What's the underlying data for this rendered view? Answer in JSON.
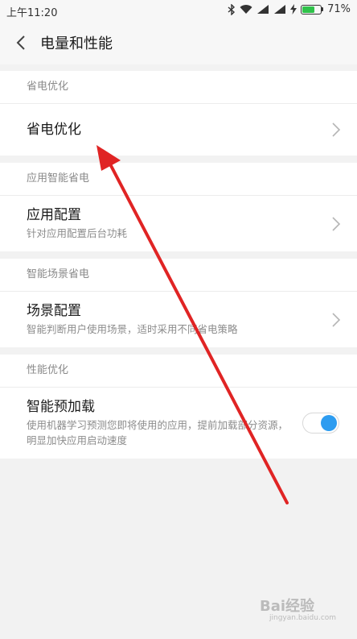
{
  "status_bar": {
    "time": "上午11:20",
    "battery_percent": "71%",
    "battery_level": 0.71,
    "icons": [
      "bluetooth-icon",
      "wifi-icon",
      "signal-icon",
      "signal-icon",
      "charging-icon",
      "battery-icon"
    ]
  },
  "header": {
    "title": "电量和性能",
    "back_icon": "chevron-left-icon"
  },
  "sections": [
    {
      "header": "省电优化",
      "items": [
        {
          "label": "省电优化",
          "description": "",
          "control": "chevron-right-icon"
        }
      ]
    },
    {
      "header": "应用智能省电",
      "items": [
        {
          "label": "应用配置",
          "description": "针对应用配置后台功耗",
          "control": "chevron-right-icon"
        }
      ]
    },
    {
      "header": "智能场景省电",
      "items": [
        {
          "label": "场景配置",
          "description": "智能判断用户使用场景，适时采用不同省电策略",
          "control": "chevron-right-icon"
        }
      ]
    },
    {
      "header": "性能优化",
      "items": [
        {
          "label": "智能预加载",
          "description": "使用机器学习预测您即将使用的应用，提前加载部分资源，明显加快应用启动速度",
          "control": "toggle",
          "toggle_on": true
        }
      ]
    }
  ],
  "colors": {
    "accent": "#2d9cf0",
    "annotation_arrow": "#e02424",
    "battery": "#2fc24a"
  },
  "watermark": {
    "text": "Bai经验",
    "sub": "jingyan.baidu.com"
  }
}
